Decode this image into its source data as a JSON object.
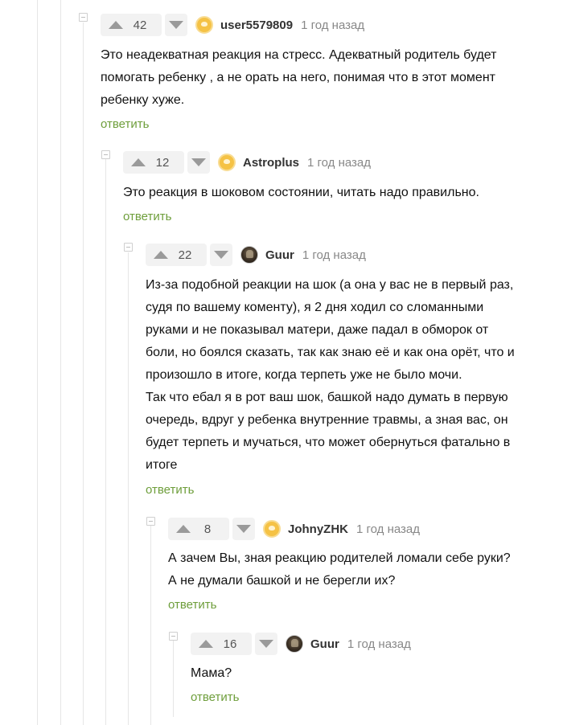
{
  "comments": [
    {
      "votes": "42",
      "username": "user5579809",
      "time": "1 год назад",
      "avatar": "default-avatar-icon",
      "text": [
        "Это неадекватная реакция на стресс. Адекватный родитель будет",
        "помогать ребенку , а не орать на него, понимая что в этот момент",
        "ребенку хуже."
      ],
      "reply_label": "ответить"
    },
    {
      "votes": "12",
      "username": "Astroplus",
      "time": "1 год назад",
      "avatar": "default-avatar-icon",
      "text": [
        "Это реакция в шоковом состоянии, читать надо правильно."
      ],
      "reply_label": "ответить"
    },
    {
      "votes": "22",
      "username": "Guur",
      "time": "1 год назад",
      "avatar": "photo-avatar-icon",
      "text": [
        "Из-за подобной реакции на шок (а она у вас не в первый раз,",
        "судя по вашему коменту), я 2 дня ходил со сломанными",
        "руками и не показывал матери, даже падал в обморок от",
        "боли, но боялся сказать, так как знаю её и как она орёт, что и",
        "произошло в итоге, когда терпеть уже не было мочи.",
        "Так что ебал я в рот ваш шок, башкой надо думать в первую",
        "очередь, вдруг у ребенка внутренние травмы, а зная вас, он",
        "будет терпеть и мучаться, что может обернуться фатально в",
        "итоге"
      ],
      "reply_label": "ответить"
    },
    {
      "votes": "8",
      "username": "JohnyZHK",
      "time": "1 год назад",
      "avatar": "default-avatar-icon",
      "text": [
        "А зачем Вы, зная реакцию родителей ломали себе руки?",
        "А не думали башкой и не берегли их?"
      ],
      "reply_label": "ответить"
    },
    {
      "votes": "16",
      "username": "Guur",
      "time": "1 год назад",
      "avatar": "photo-avatar-icon",
      "text": [
        "Мама?"
      ],
      "reply_label": "ответить"
    }
  ]
}
